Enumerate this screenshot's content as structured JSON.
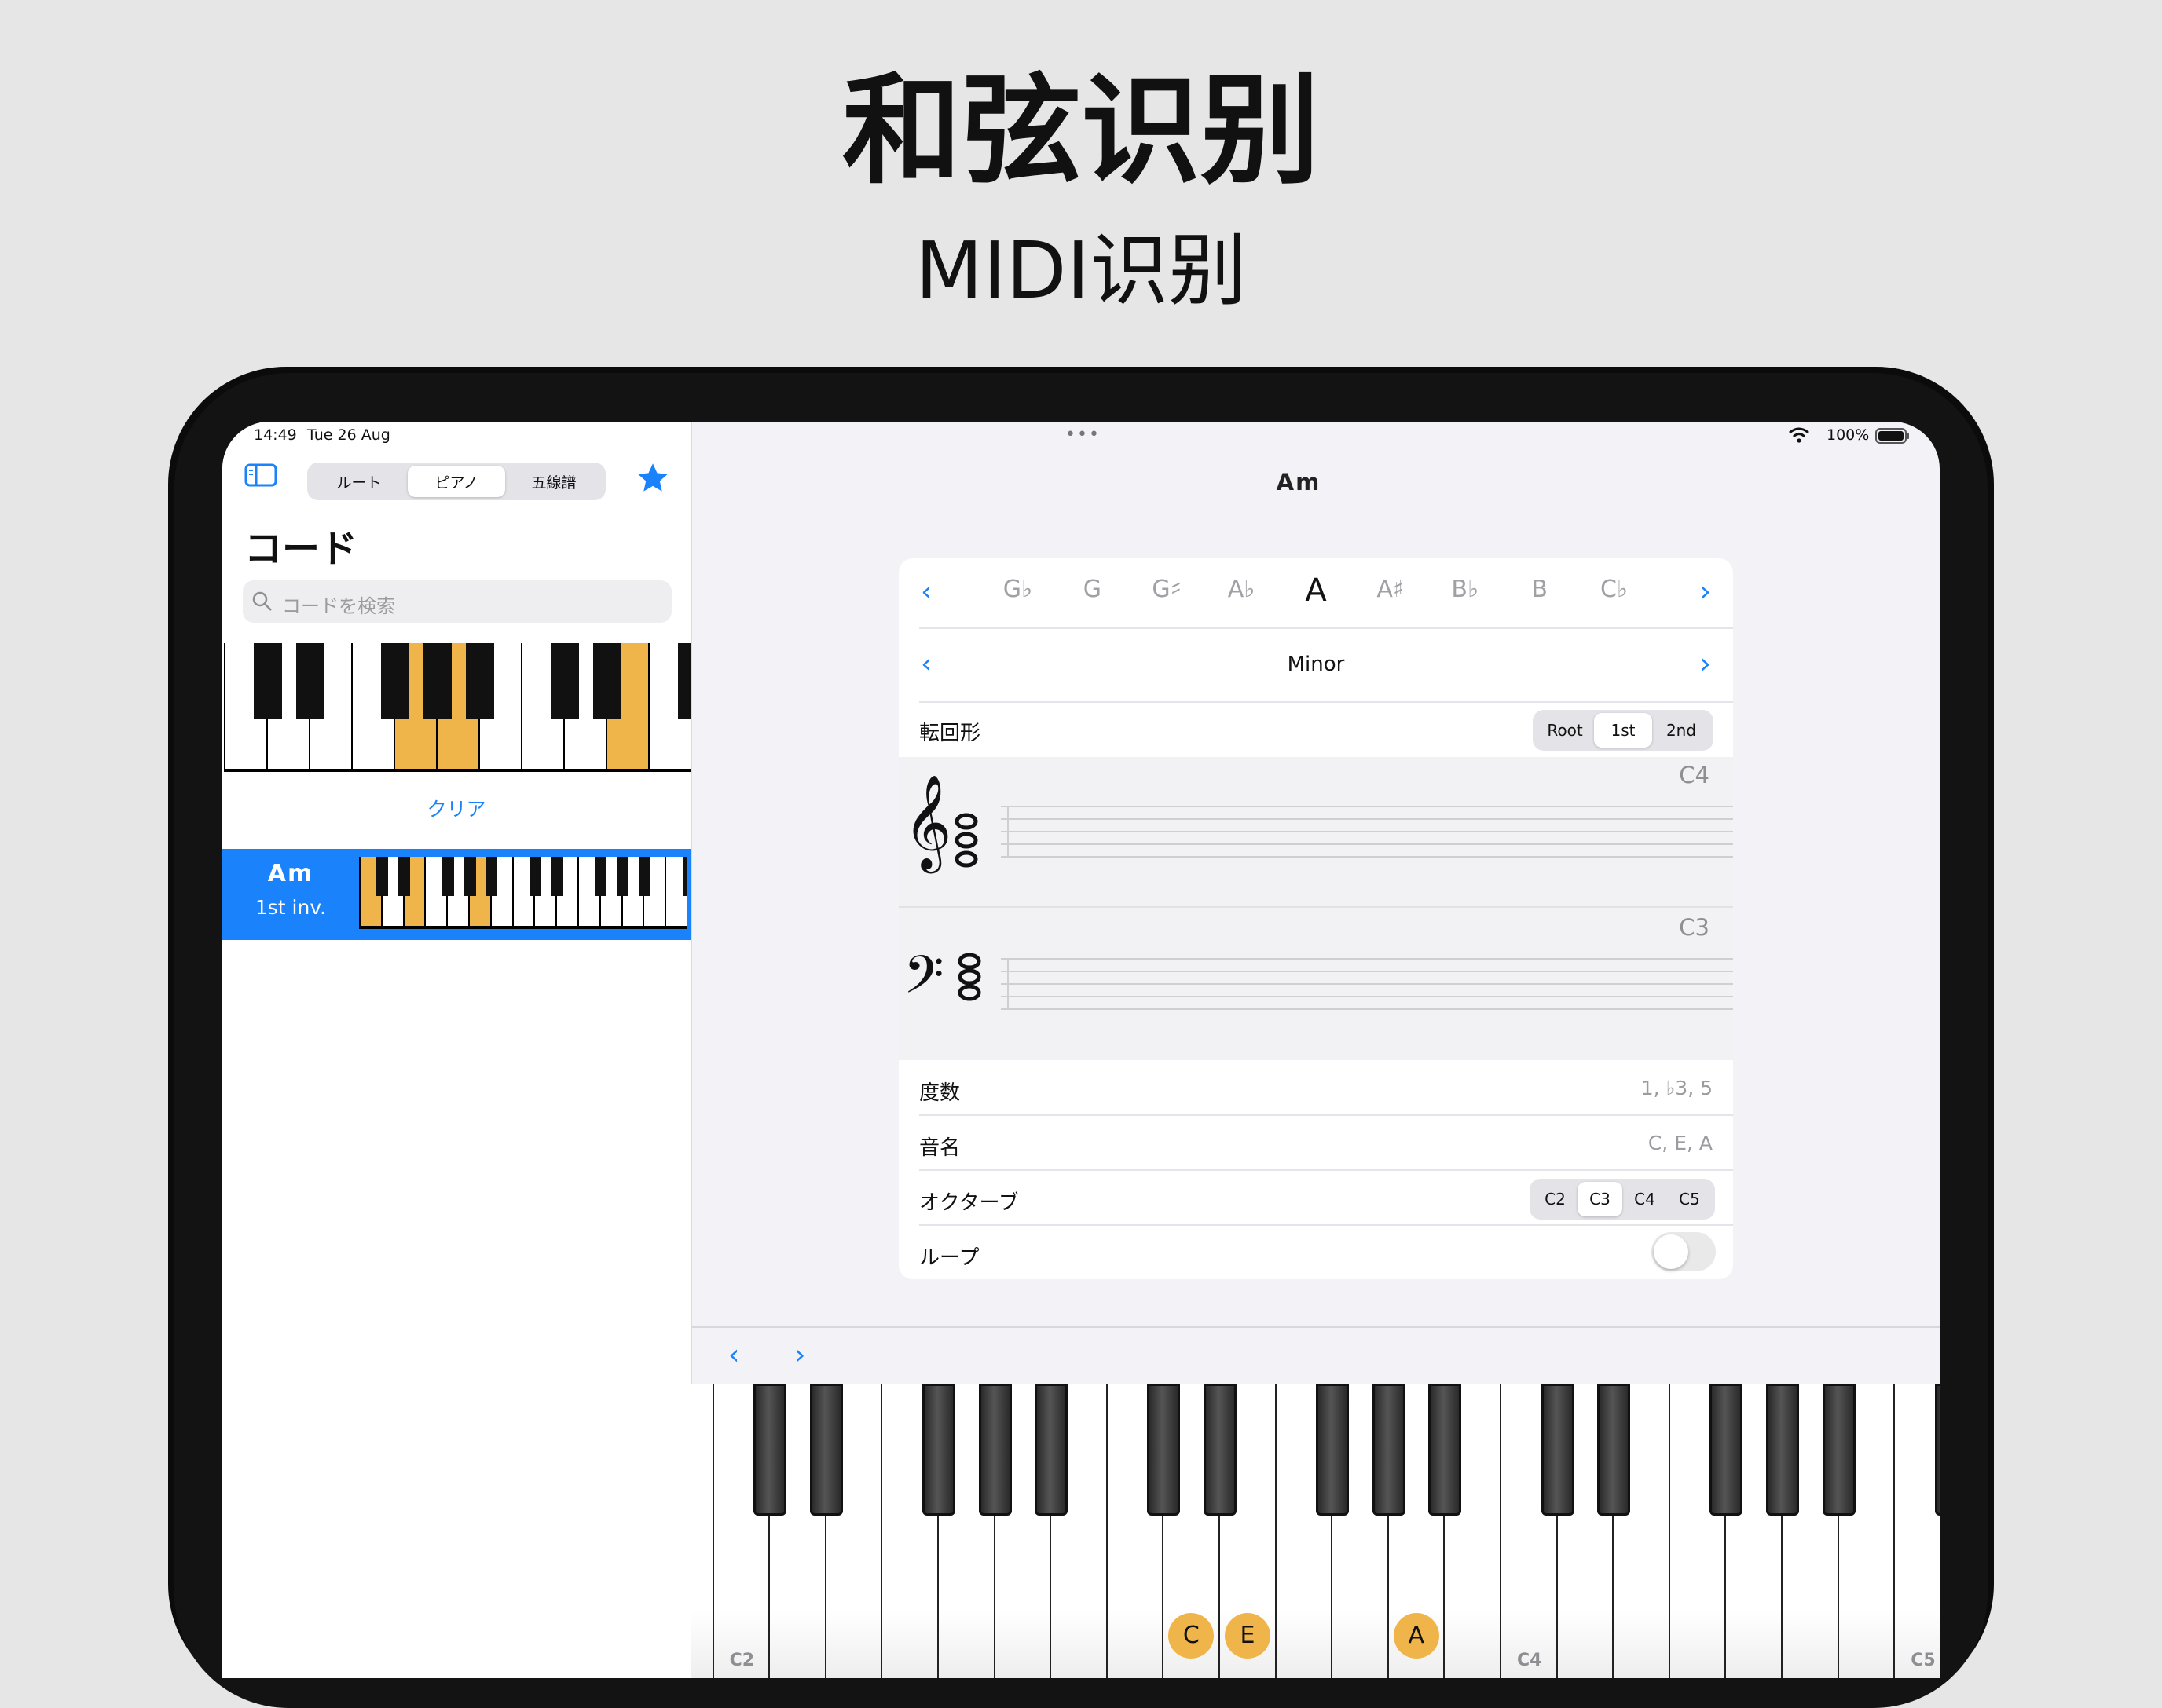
{
  "headline": "和弦识别",
  "subline": "MIDI识别",
  "status_bar": {
    "time": "14:49",
    "date": "Tue 26 Aug",
    "battery": "100%",
    "more_dots": "•••"
  },
  "sidebar": {
    "tabs": [
      {
        "label": "ルート",
        "selected": false
      },
      {
        "label": "ピアノ",
        "selected": true
      },
      {
        "label": "五線譜",
        "selected": false
      }
    ],
    "title": "コード",
    "search_placeholder": "コードを検索",
    "clear_label": "クリア",
    "entry": {
      "chord": "Am",
      "inversion": "1st inv."
    }
  },
  "main": {
    "nav_title": "Am",
    "roots": [
      "G♭",
      "G",
      "G♯",
      "A♭",
      "A",
      "A♯",
      "B♭",
      "B",
      "C♭"
    ],
    "selected_root": "A",
    "quality": "Minor",
    "inversion_label": "転回形",
    "inversion_options": [
      "Root",
      "1st",
      "2nd"
    ],
    "inversion_selected": "1st",
    "treble_octave": "C4",
    "bass_octave": "C3",
    "degrees_label": "度数",
    "degrees_value": "1, ♭3, 5",
    "notes_label": "音名",
    "notes_value": "C, E, A",
    "octave_label": "オクターブ",
    "octave_options": [
      "C2",
      "C3",
      "C4",
      "C5"
    ],
    "octave_selected": "C3",
    "loop_label": "ループ",
    "loop_on": false
  },
  "keyboard": {
    "labels": [
      "C2",
      "C4",
      "C5"
    ],
    "pressed": [
      "C",
      "E",
      "A"
    ]
  },
  "colors": {
    "accent": "#1a82fb",
    "highlight": "#f0b54a",
    "selected_row": "#1a82fb"
  }
}
